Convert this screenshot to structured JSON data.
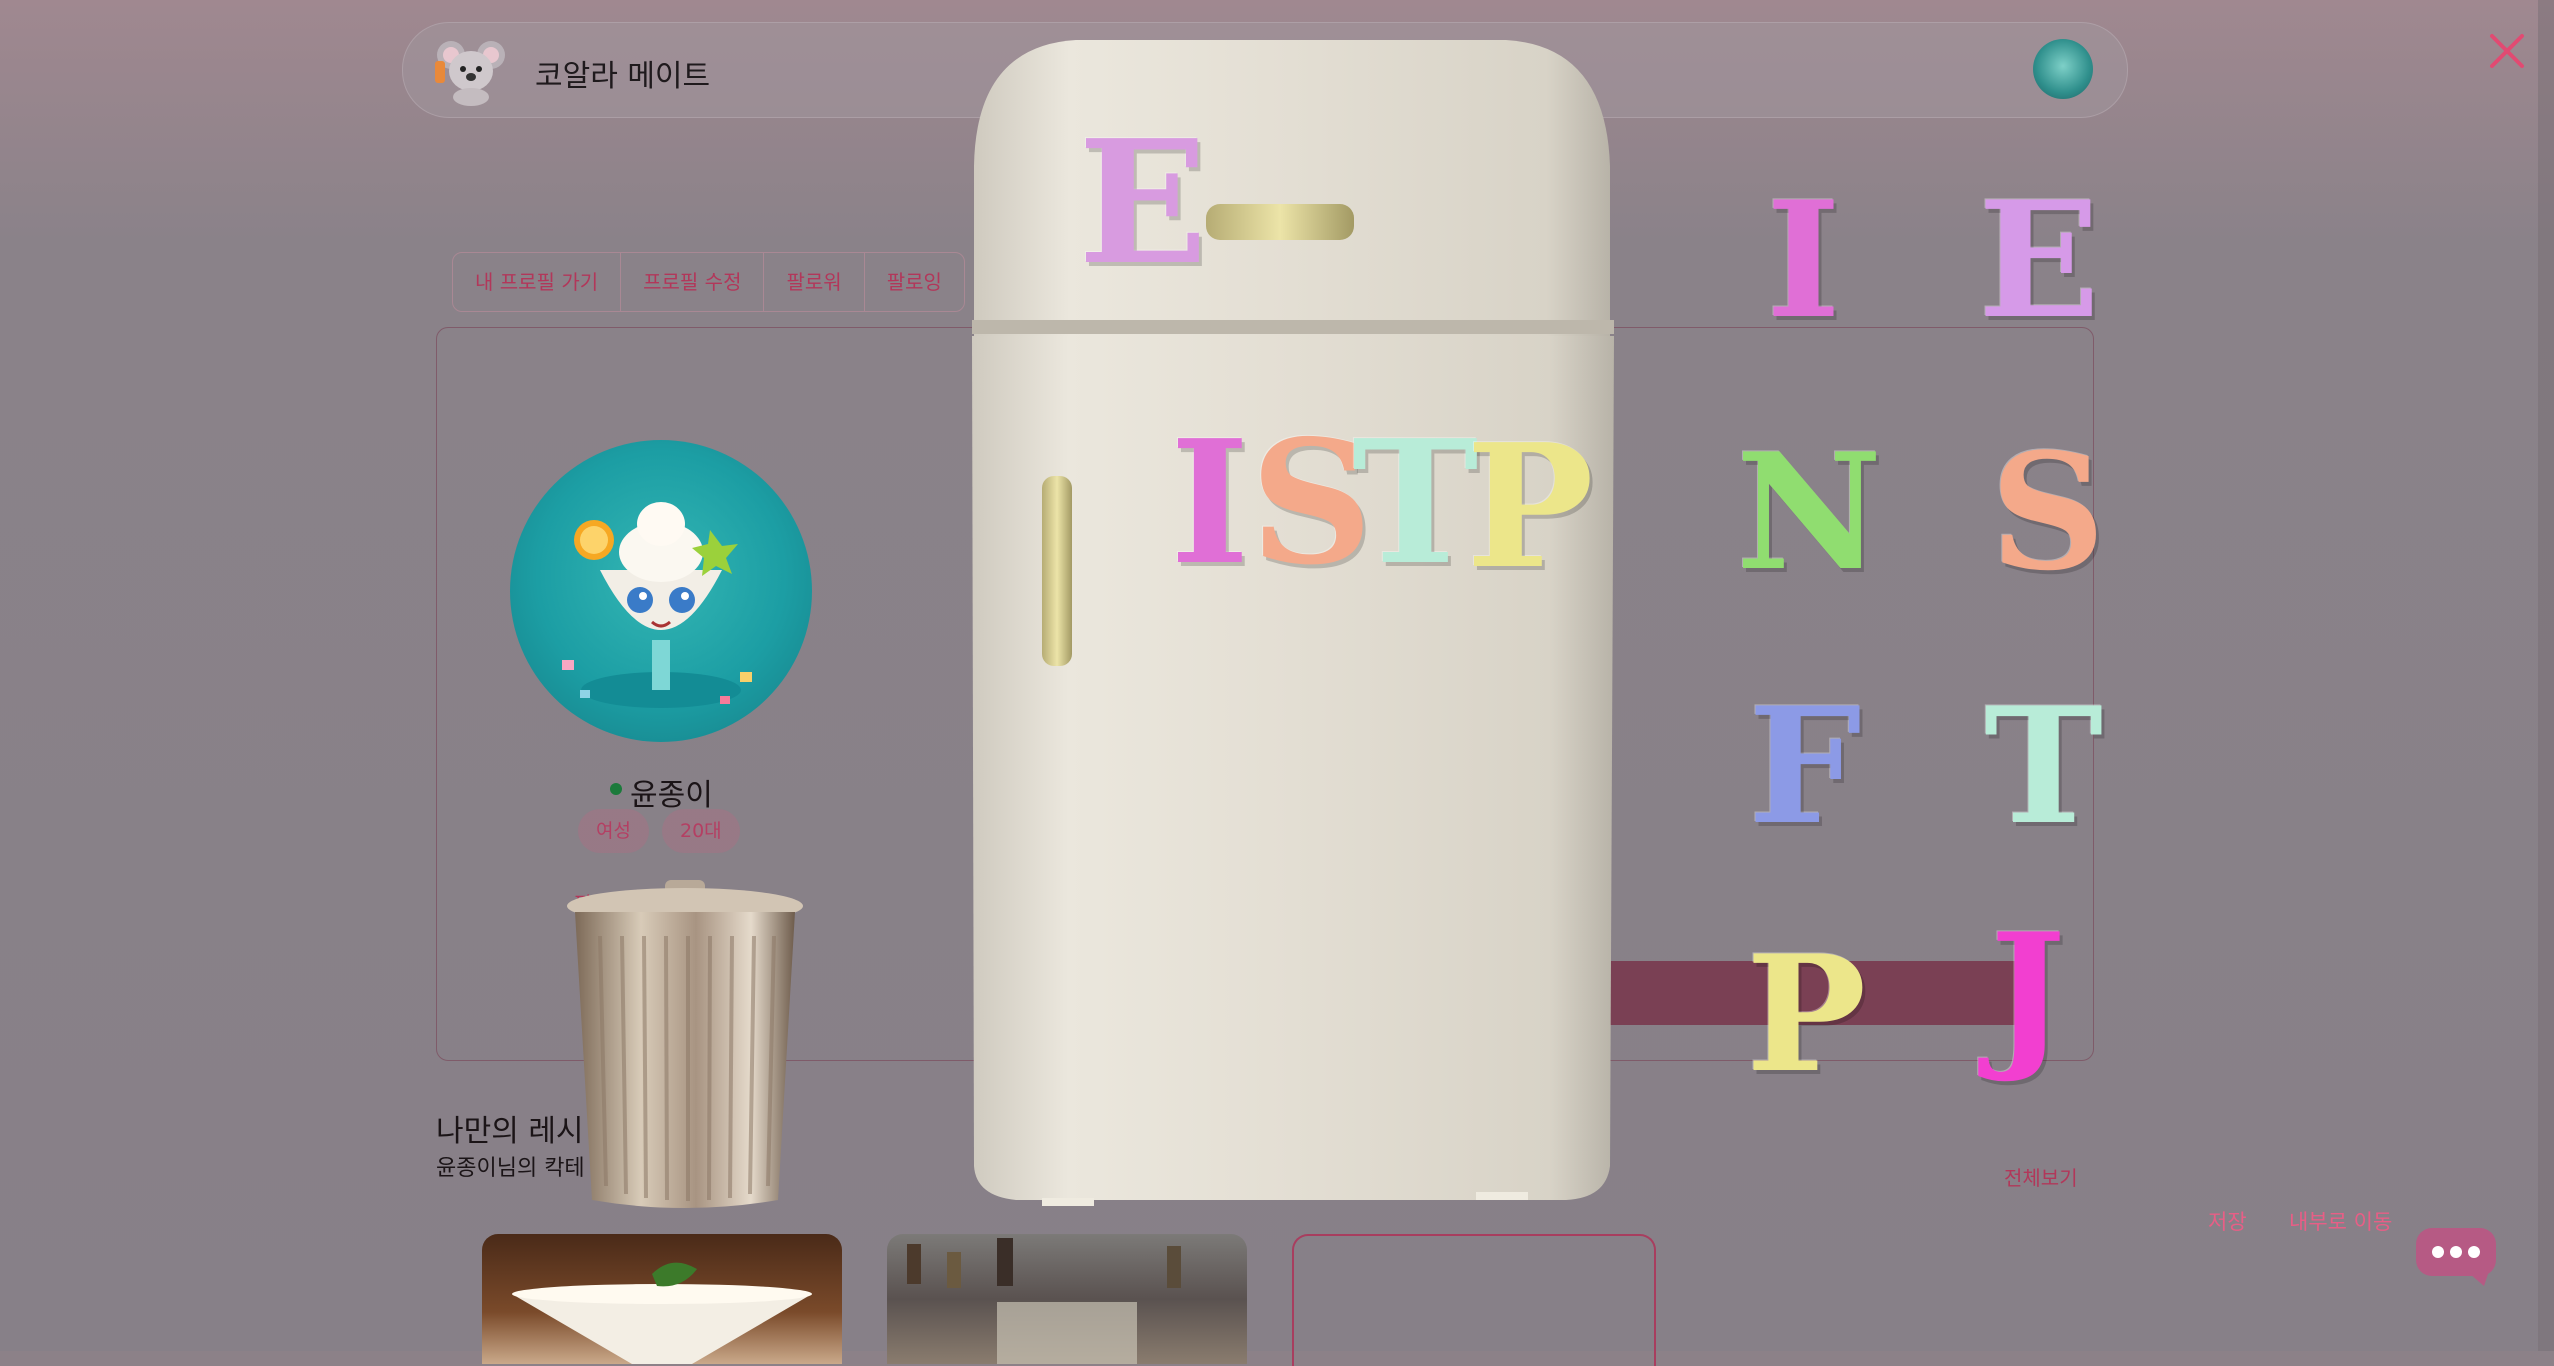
{
  "app": {
    "title": "코알라 메이트"
  },
  "tabs": [
    "내 프로필 가기",
    "프로필 수정",
    "팔로워",
    "팔로잉"
  ],
  "profile": {
    "name": "윤종이",
    "tags": [
      "여성",
      "20대"
    ],
    "follow_label": "팔로워"
  },
  "recipes": {
    "title": "나만의 레시",
    "subtitle": "윤종이님의 칵테",
    "view_all": "전체보기"
  },
  "actions": {
    "save": "저장",
    "move_inside": "내부로 이동"
  },
  "fridge_magnets": [
    "E",
    "I",
    "S",
    "T",
    "P"
  ],
  "mbti_letters": {
    "row1": [
      "I",
      "E"
    ],
    "row2": [
      "N",
      "S"
    ],
    "row3": [
      "F",
      "T"
    ],
    "row4": [
      "P",
      "J"
    ]
  },
  "colors": {
    "accent": "#b2375a",
    "letter_E_magnet": "#d89be0",
    "letter_I": "#e06fd6",
    "letter_S": "#f4a98a",
    "letter_T": "#b8ecd8",
    "letter_P": "#ece68a",
    "letter_E": "#d69ae8",
    "letter_N": "#90dd70",
    "letter_F": "#8c9ae6",
    "letter_J": "#f23fd0"
  }
}
